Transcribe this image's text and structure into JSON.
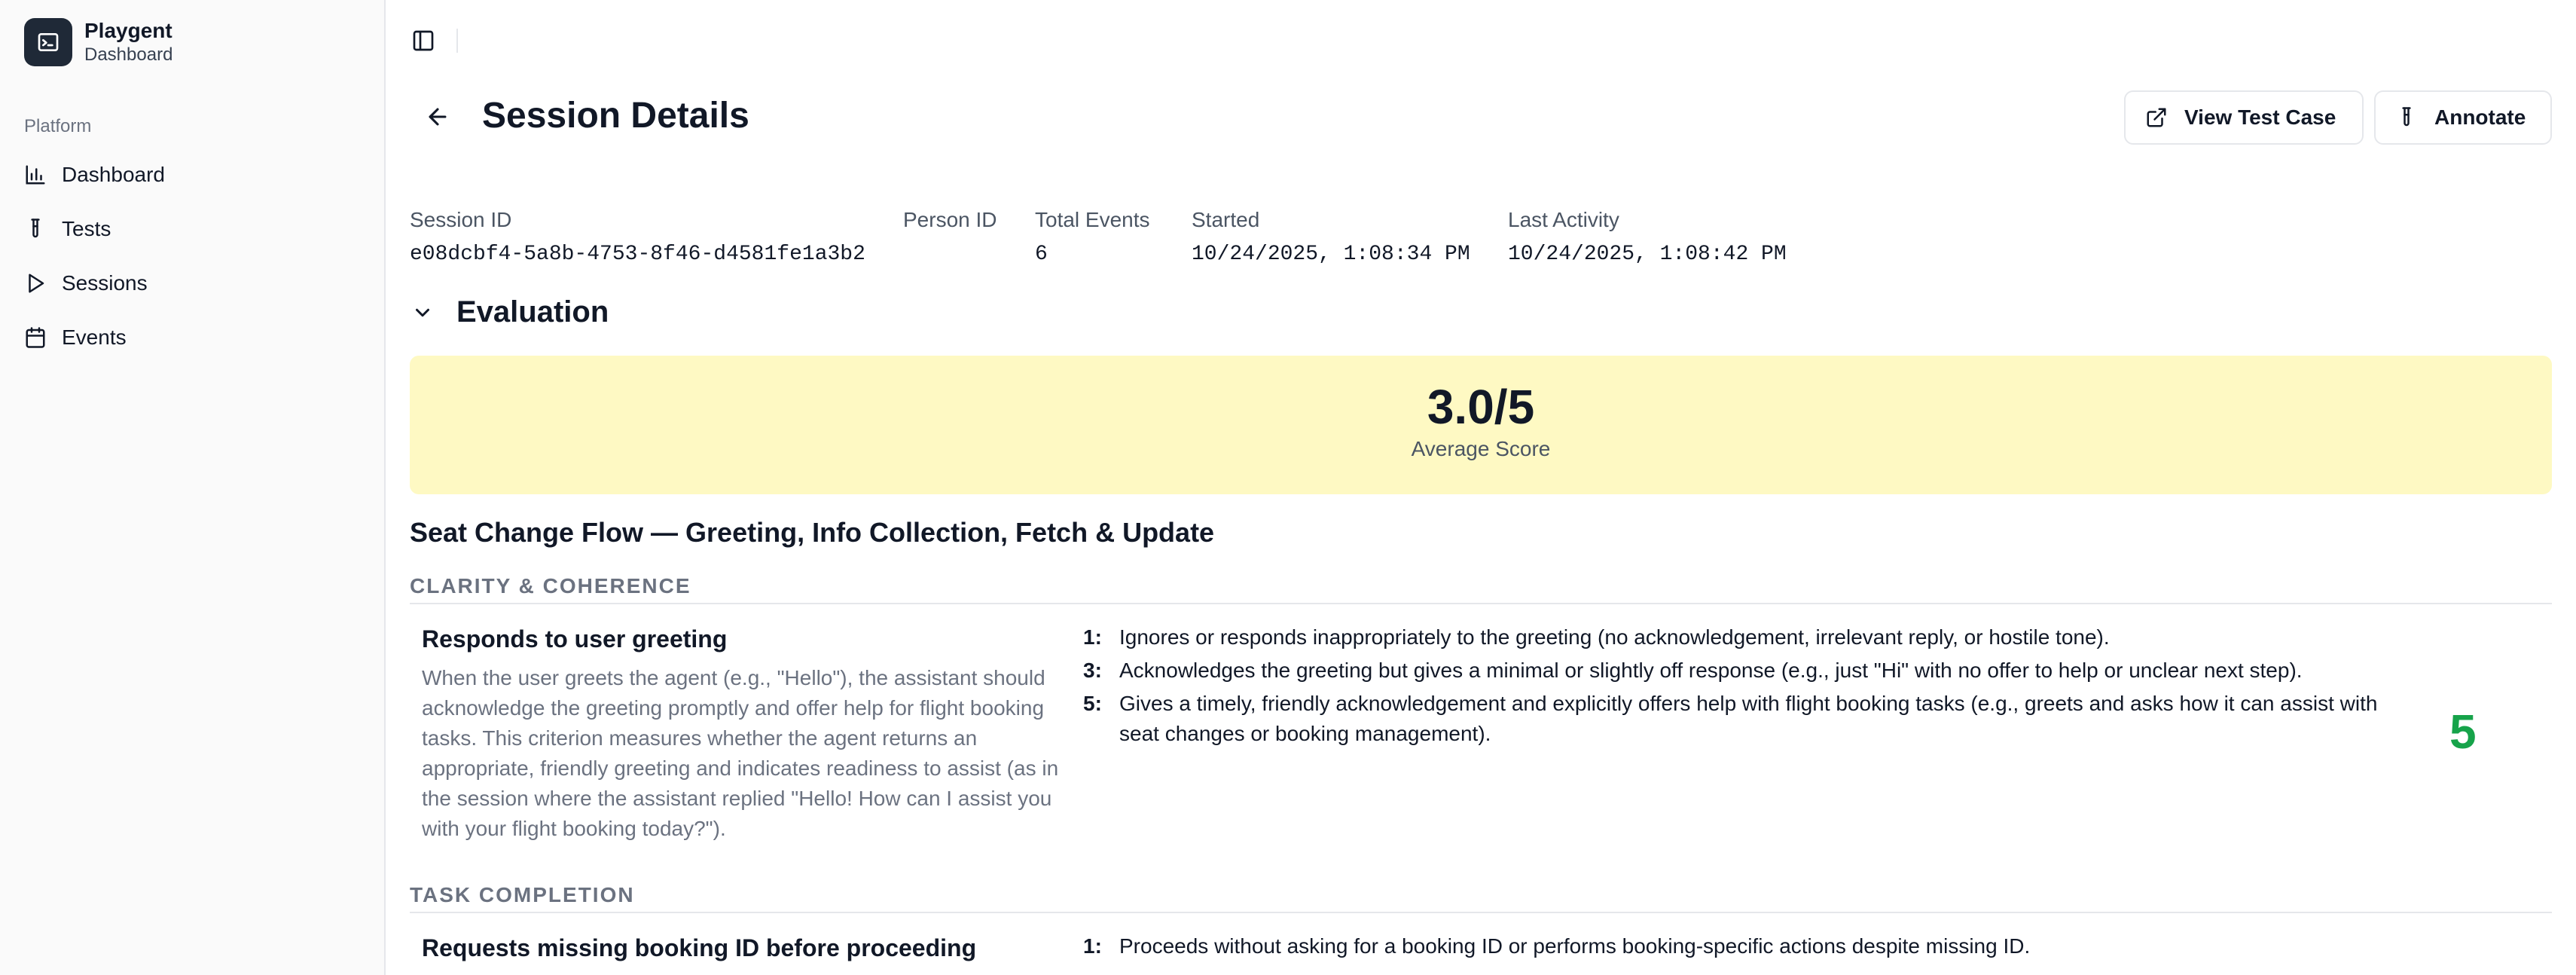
{
  "brand": {
    "name": "Playgent",
    "subtitle": "Dashboard",
    "icon": "terminal-icon"
  },
  "sidebar": {
    "group_label": "Platform",
    "items": [
      {
        "label": "Dashboard",
        "icon": "bar-chart-icon"
      },
      {
        "label": "Tests",
        "icon": "test-tube-icon"
      },
      {
        "label": "Sessions",
        "icon": "play-icon"
      },
      {
        "label": "Events",
        "icon": "calendar-icon"
      }
    ]
  },
  "header": {
    "title": "Session Details",
    "view_test_case_label": "View Test Case",
    "annotate_label": "Annotate"
  },
  "meta": {
    "session_id_label": "Session ID",
    "session_id": "e08dcbf4-5a8b-4753-8f46-d4581fe1a3b2",
    "person_id_label": "Person ID",
    "person_id": "",
    "total_events_label": "Total Events",
    "total_events": "6",
    "started_label": "Started",
    "started": "10/24/2025, 1:08:34 PM",
    "last_activity_label": "Last Activity",
    "last_activity": "10/24/2025, 1:08:42 PM"
  },
  "evaluation": {
    "title": "Evaluation",
    "average_score": "3.0/5",
    "average_label": "Average Score",
    "average_score_numeric": 3.0,
    "score_card_color": "#fef9c3",
    "flow_title": "Seat Change Flow — Greeting, Info Collection, Fetch & Update",
    "sections": [
      {
        "heading": "CLARITY & COHERENCE",
        "criterion": "Responds to user greeting",
        "description": "When the user greets the agent (e.g., \"Hello\"), the assistant should acknowledge the greeting promptly and offer help for flight booking tasks. This criterion measures whether the agent returns an appropriate, friendly greeting and indicates readiness to assist (as in the session where the assistant replied \"Hello! How can I assist you with your flight booking today?\").",
        "rubric": [
          {
            "num": "1:",
            "text": "Ignores or responds inappropriately to the greeting (no acknowledgement, irrelevant reply, or hostile tone)."
          },
          {
            "num": "3:",
            "text": "Acknowledges the greeting but gives a minimal or slightly off response (e.g., just \"Hi\" with no offer to help or unclear next step)."
          },
          {
            "num": "5:",
            "text": "Gives a timely, friendly acknowledgement and explicitly offers help with flight booking tasks (e.g., greets and asks how it can assist with seat changes or booking management)."
          }
        ],
        "score": "5",
        "score_color": "#16a34a"
      },
      {
        "heading": "TASK COMPLETION",
        "criterion": "Requests missing booking ID before proceeding",
        "rubric": [
          {
            "num": "1:",
            "text": "Proceeds without asking for a booking ID or performs booking-specific actions despite missing ID."
          }
        ]
      }
    ]
  }
}
